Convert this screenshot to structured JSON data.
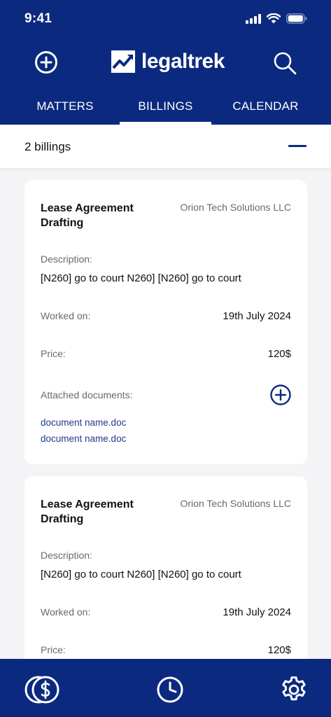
{
  "status_bar": {
    "time": "9:41"
  },
  "header": {
    "logo_text": "legaltrek",
    "add_icon": "plus-circle-icon",
    "search_icon": "search-icon"
  },
  "tabs": [
    {
      "label": "MATTERS",
      "active": false
    },
    {
      "label": "BILLINGS",
      "active": true
    },
    {
      "label": "CALENDAR",
      "active": false
    }
  ],
  "summary": {
    "count_text": "2 billings",
    "collapse_icon": "minus-icon"
  },
  "labels": {
    "description": "Description:",
    "worked_on": "Worked on:",
    "price": "Price:",
    "attached_documents": "Attached documents:"
  },
  "billings": [
    {
      "title": "Lease Agreement Drafting",
      "client": "Orion Tech Solutions LLC",
      "description": "[N260] go to court N260] [N260] go to court",
      "worked_on": "19th July 2024",
      "price": "120$",
      "documents": [
        "document name.doc",
        "document name.doc"
      ]
    },
    {
      "title": "Lease Agreement Drafting",
      "client": "Orion Tech Solutions LLC",
      "description": "[N260] go to court N260] [N260] go to court",
      "worked_on": "19th July 2024",
      "price": "120$"
    }
  ],
  "bottom_nav": [
    {
      "icon": "billing-coins-icon"
    },
    {
      "icon": "clock-icon"
    },
    {
      "icon": "gear-icon"
    }
  ],
  "colors": {
    "primary": "#0b2a7f",
    "link": "#1f3c8a",
    "background": "#f4f4f6"
  }
}
